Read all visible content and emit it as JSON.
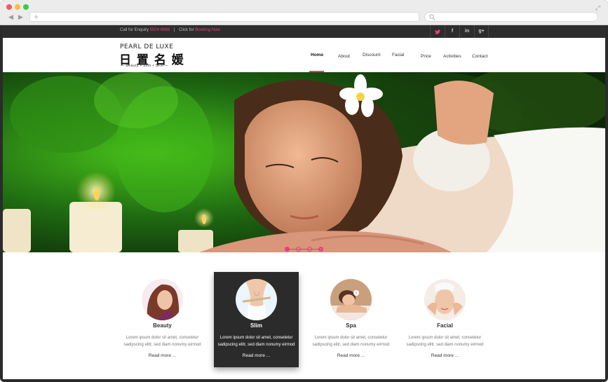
{
  "topbar": {
    "call_label": "Call for Enquiry",
    "phone": "5509 6988",
    "separator": "|",
    "click_label": "Click for",
    "booking": "Booking Now",
    "social": [
      "twitter-icon",
      "facebook-icon",
      "linkedin-icon",
      "google-plus-icon"
    ],
    "social_glyphs": {
      "tw": "🐦",
      "fb": "f",
      "li": "in",
      "gp": "g+"
    }
  },
  "logo": {
    "english": "PEARL DE LUXE",
    "chinese": "日 置 名 媛",
    "subtitle": "— Beauty • Slim • SPA —"
  },
  "menu": {
    "items": [
      {
        "label": "Home",
        "active": true
      },
      {
        "label": "About"
      },
      {
        "label": "Discount"
      },
      {
        "label": "Facial"
      },
      {
        "label": "Price"
      },
      {
        "label": "Activities"
      },
      {
        "label": "Contact"
      }
    ]
  },
  "slider": {
    "slides": 4,
    "active_index": 0
  },
  "services": [
    {
      "title": "Beauty",
      "desc": "Lorem ipsum dolor sit amet, consetetur sadipscing elitr, sed diam nonumy eirmod",
      "more": "Read more ..."
    },
    {
      "title": "Slim",
      "desc": "Lorem ipsum dolor sit amet, consetetur sadipscing elitr, sed diam nonumy eirmod",
      "more": "Read more ..."
    },
    {
      "title": "Spa",
      "desc": "Lorem ipsum dolor sit amet, consetetur sadipscing elitr, sed diam nonumy eirmod",
      "more": "Read more ..."
    },
    {
      "title": "Facial",
      "desc": "Lorem ipsum dolor sit amet, consetetur sadipscing elitr, sed diam nonumy eirmod",
      "more": "Read more ..."
    }
  ],
  "colors": {
    "accent": "#e83e7a",
    "topbar": "#2d2d2d",
    "highlight_card": "#2b2b2b"
  }
}
